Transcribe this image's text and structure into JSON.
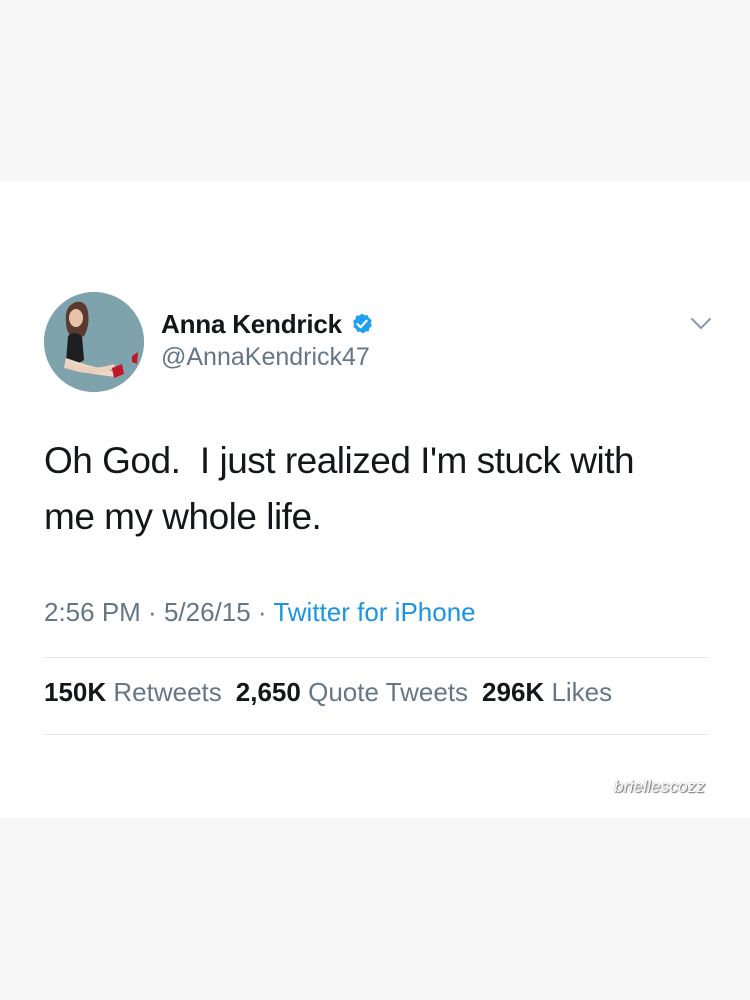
{
  "tweet": {
    "display_name": "Anna Kendrick",
    "verified": true,
    "handle": "@AnnaKendrick47",
    "text": "Oh God.  I just realized I'm stuck with\nme my whole life.",
    "time": "2:56 PM",
    "date": "5/26/15",
    "separator": " · ",
    "source": "Twitter for iPhone",
    "stats": {
      "retweets_count": "150K",
      "retweets_label": "Retweets",
      "quotes_count": "2,650",
      "quotes_label": "Quote Tweets",
      "likes_count": "296K",
      "likes_label": "Likes"
    }
  },
  "watermark": "briellescozz",
  "colors": {
    "link_blue": "#1b95e0",
    "verified_blue": "#1da1f2",
    "text_primary": "#14171a",
    "text_secondary": "#657786",
    "background": "#f7f7f7",
    "card": "#ffffff"
  },
  "icons": {
    "verified": "verified-badge-icon",
    "more": "chevron-down-icon"
  }
}
